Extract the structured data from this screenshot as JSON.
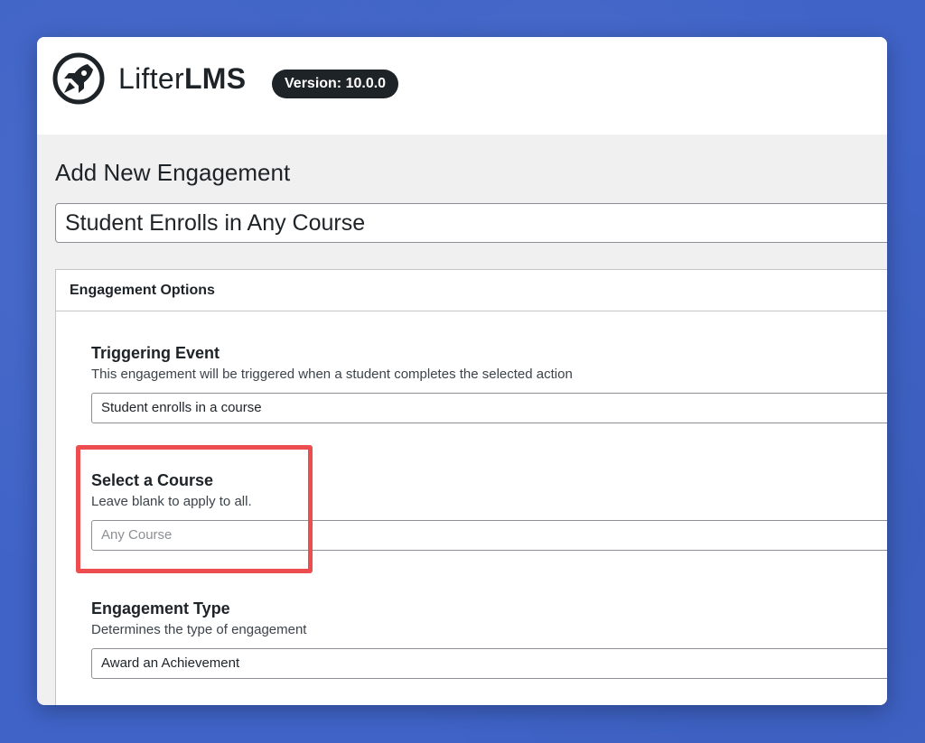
{
  "app": {
    "logo_text_light": "Lifter",
    "logo_text_bold": "LMS",
    "version_badge": "Version: 10.0.0"
  },
  "page": {
    "title": "Add New Engagement",
    "post_title_value": "Student Enrolls in Any Course"
  },
  "metabox": {
    "header": "Engagement Options",
    "fields": [
      {
        "label": "Triggering Event",
        "description": "This engagement will be triggered when a student completes the selected action",
        "value": "Student enrolls in a course"
      },
      {
        "label": "Select a Course",
        "description": "Leave blank to apply to all.",
        "placeholder": "Any Course"
      },
      {
        "label": "Engagement Type",
        "description": "Determines the type of engagement",
        "value": "Award an Achievement"
      }
    ]
  },
  "colors": {
    "background": "#3f63c7",
    "highlight": "#ee4d50",
    "text": "#1d2327"
  },
  "icons": {
    "logo": "rocket-icon"
  }
}
